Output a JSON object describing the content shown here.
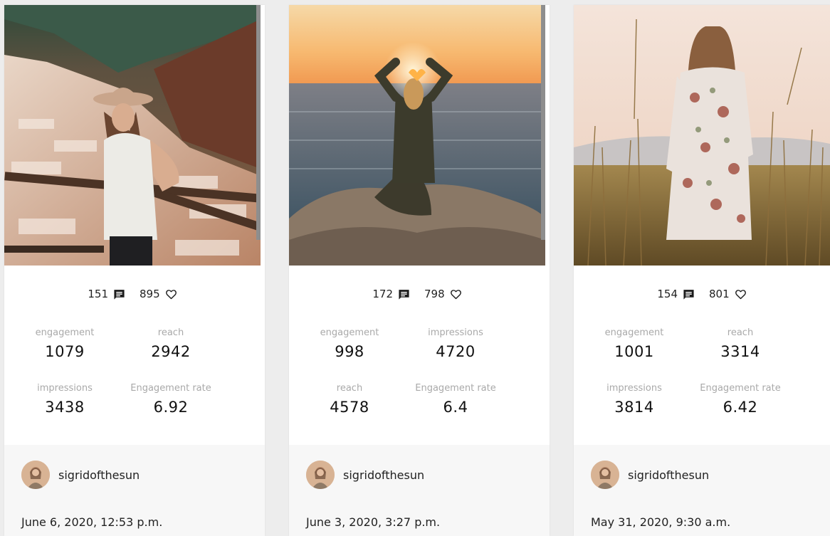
{
  "posts": [
    {
      "comments": "151",
      "likes": "895",
      "metrics": [
        {
          "label": "engagement",
          "value": "1079"
        },
        {
          "label": "reach",
          "value": "2942"
        },
        {
          "label": "impressions",
          "value": "3438"
        },
        {
          "label": "Engagement rate",
          "value": "6.92"
        }
      ],
      "author": "sigridofthesun",
      "date": "June 6, 2020, 12:53 p.m."
    },
    {
      "comments": "172",
      "likes": "798",
      "metrics": [
        {
          "label": "engagement",
          "value": "998"
        },
        {
          "label": "impressions",
          "value": "4720"
        },
        {
          "label": "reach",
          "value": "4578"
        },
        {
          "label": "Engagement rate",
          "value": "6.4"
        }
      ],
      "author": "sigridofthesun",
      "date": "June 3, 2020, 3:27 p.m."
    },
    {
      "comments": "154",
      "likes": "801",
      "metrics": [
        {
          "label": "engagement",
          "value": "1001"
        },
        {
          "label": "reach",
          "value": "3314"
        },
        {
          "label": "impressions",
          "value": "3814"
        },
        {
          "label": "Engagement rate",
          "value": "6.42"
        }
      ],
      "author": "sigridofthesun",
      "date": "May 31, 2020, 9:30 a.m."
    }
  ],
  "icons": {
    "comment": "comment-icon",
    "like": "heart-icon"
  },
  "colors": {
    "page_bg": "#ededed",
    "card_bg": "#ffffff",
    "footer_bg": "#f7f7f7",
    "label": "#a9a9a9"
  }
}
